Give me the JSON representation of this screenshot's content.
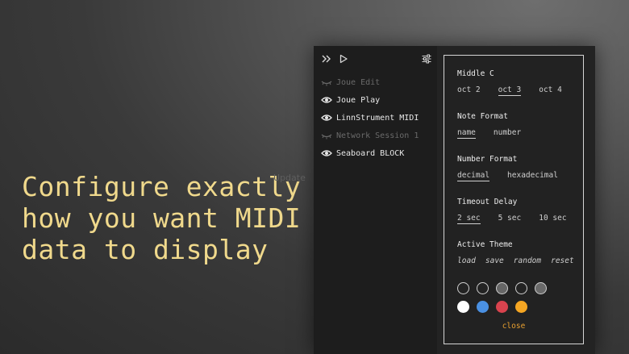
{
  "headline": {
    "lines": [
      "Configure exactly",
      "how you want MIDI",
      "data to display"
    ]
  },
  "toolbar": {
    "expand_icon": "double-chevron-right-icon",
    "play_icon": "play-icon",
    "settings_icon": "sliders-icon"
  },
  "devices": [
    {
      "label": "Joue Edit",
      "visible": false
    },
    {
      "label": "Joue Play",
      "visible": true
    },
    {
      "label": "LinnStrument MIDI",
      "visible": true
    },
    {
      "label": "Network Session 1",
      "visible": false
    },
    {
      "label": "Seaboard BLOCK",
      "visible": true
    }
  ],
  "ghost_text": "Update",
  "settings": {
    "middle_c": {
      "title": "Middle C",
      "options": [
        "oct 2",
        "oct 3",
        "oct 4"
      ],
      "selected": "oct 3"
    },
    "note_format": {
      "title": "Note Format",
      "options": [
        "name",
        "number"
      ],
      "selected": "name"
    },
    "number_format": {
      "title": "Number Format",
      "options": [
        "decimal",
        "hexadecimal"
      ],
      "selected": "decimal"
    },
    "timeout_delay": {
      "title": "Timeout Delay",
      "options": [
        "2 sec",
        "5 sec",
        "10 sec"
      ],
      "selected": "2 sec"
    },
    "active_theme": {
      "title": "Active Theme",
      "actions": [
        "load",
        "save",
        "random",
        "reset"
      ]
    },
    "swatches": {
      "row1": [
        "#232323",
        "#232323",
        "#666666",
        "#232323",
        "#6a6a6a"
      ],
      "row2": [
        "#ffffff",
        "#4a90e2",
        "#d9434e",
        "#f5a623"
      ]
    },
    "close_label": "close"
  },
  "colors": {
    "accent": "#e8a030",
    "headline": "#f0d98c"
  }
}
